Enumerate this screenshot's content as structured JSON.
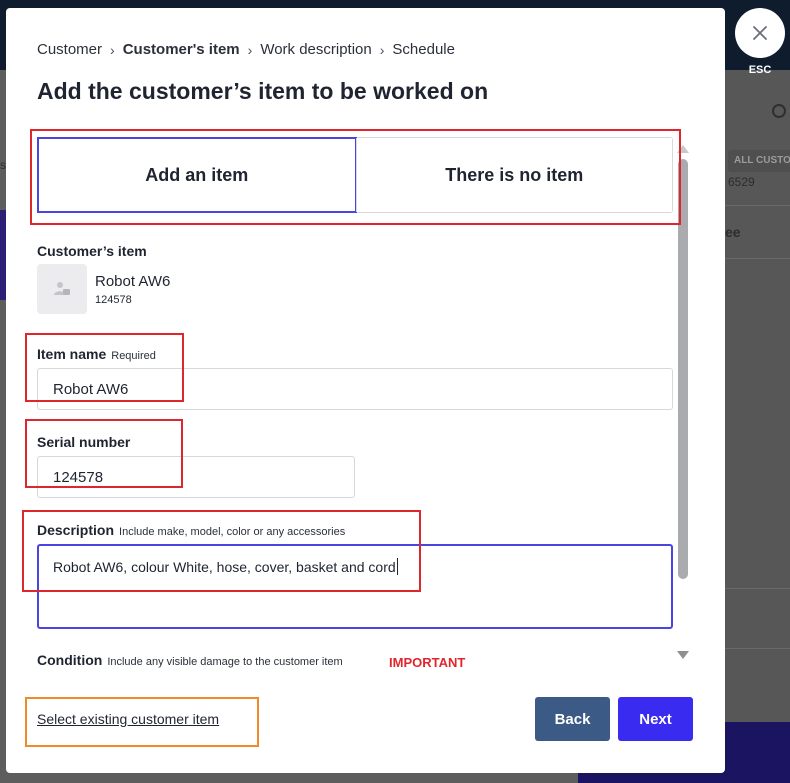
{
  "background": {
    "chip_label": "ALL CUSTO",
    "chip_number": "6529",
    "row_text": "ee",
    "s_text": "s"
  },
  "close": {
    "label": "ESC"
  },
  "breadcrumb": {
    "items": [
      "Customer",
      "Customer's item",
      "Work description",
      "Schedule"
    ],
    "active_index": 1
  },
  "title": "Add the customer’s item to be worked on",
  "toggle": {
    "options": [
      "Add an item",
      "There is no item"
    ],
    "selected": "Add an item"
  },
  "customer_item": {
    "section_label": "Customer’s item",
    "name": "Robot AW6",
    "serial": "124578"
  },
  "fields": {
    "item_name": {
      "label": "Item name",
      "hint": "Required",
      "value": "Robot AW6"
    },
    "serial_number": {
      "label": "Serial number",
      "value": "124578"
    },
    "description": {
      "label": "Description",
      "hint": "Include make, model, color or any accessories",
      "value": "Robot AW6, colour White, hose, cover, basket and cord"
    },
    "condition": {
      "label": "Condition",
      "hint": "Include any visible damage to the customer item"
    }
  },
  "annotation_note": "IMPORTANT",
  "footer": {
    "select_existing": "Select existing customer item",
    "back": "Back",
    "next": "Next"
  },
  "colors": {
    "primary": "#3a2bf0",
    "secondary": "#3b5a85",
    "annotation_red": "#e0262d",
    "annotation_orange": "#ef8a2a"
  }
}
